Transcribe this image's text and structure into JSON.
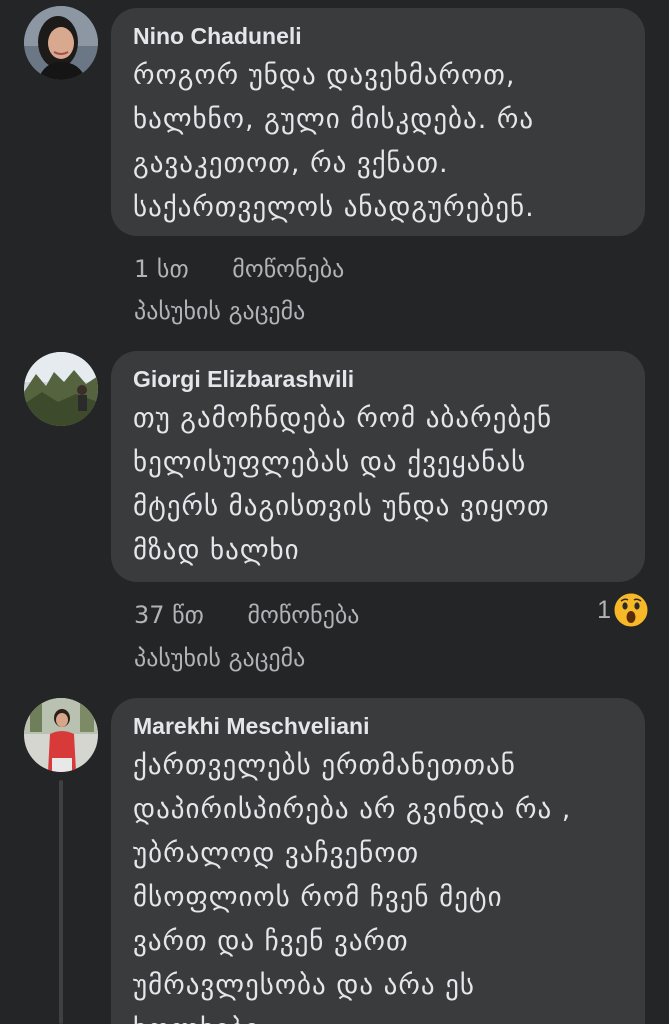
{
  "comments": [
    {
      "author": "Nino Chaduneli",
      "text": "როგორ უნდა დავეხმაროთ,\nხალხნო, გული მისკდება. რა\nგავაკეთოთ, რა ვქნათ.\nსაქართველოს ანადგურებენ.",
      "time": "1 სთ",
      "like_label": "მოწონება",
      "reply_label": "პასუხის გაცემა"
    },
    {
      "author": "Giorgi Elizbarashvili",
      "text": "თუ გამოჩნდება რომ აბარებენ\nხელისუფლებას და ქვეყანას\nმტერს მაგისთვის უნდა ვიყოთ\nმზად ხალხი",
      "time": "37 წთ",
      "like_label": "მოწონება",
      "reply_label": "პასუხის გაცემა",
      "reaction_count": "1",
      "reaction_icon": "wow-emoji-icon"
    },
    {
      "author": "Marekhi Meschveliani",
      "text": "ქართველებს ერთმანეთთან\nდაპირისპირება არ გვინდა რა ,\nუბრალოდ ვაჩვენოთ\nმსოფლიოს რომ ჩვენ მეტი\nვართ და ჩვენ ვართ\nუმრავლესობა და არა ეს\nხოლხები"
    }
  ],
  "colors": {
    "background": "#242526",
    "bubble": "#3a3b3c",
    "text": "#e4e6eb",
    "secondary": "#b0b3b8"
  }
}
